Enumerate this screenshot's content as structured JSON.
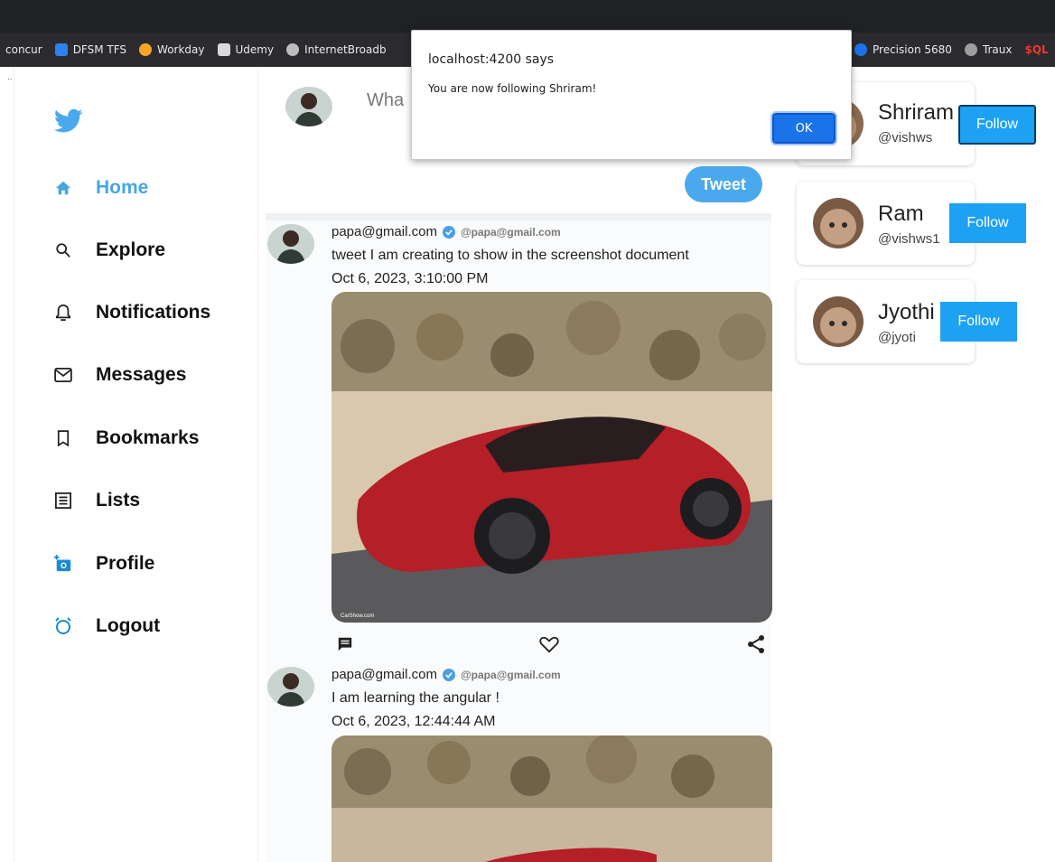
{
  "bookmarks": [
    {
      "label": "concur",
      "color": "#2b2b2f"
    },
    {
      "label": "DFSM TFS",
      "color": "#2f80ed"
    },
    {
      "label": "Workday",
      "color": "#f5a623"
    },
    {
      "label": "Udemy",
      "color": "#d9d9d9"
    },
    {
      "label": "InternetBroadb",
      "color": "#bdbdbd"
    }
  ],
  "bookmarks_right": [
    {
      "label": "Precision 5680",
      "color": "#1a73e8"
    },
    {
      "label": "Traux",
      "color": "#9e9e9e"
    },
    {
      "label": "$QL",
      "color": "#c62828"
    }
  ],
  "sidebar": {
    "items": [
      {
        "label": "Home",
        "icon": "home-icon"
      },
      {
        "label": "Explore",
        "icon": "search-icon"
      },
      {
        "label": "Notifications",
        "icon": "bell-icon"
      },
      {
        "label": "Messages",
        "icon": "mail-icon"
      },
      {
        "label": "Bookmarks",
        "icon": "bookmark-icon"
      },
      {
        "label": "Lists",
        "icon": "list-icon"
      },
      {
        "label": "Profile",
        "icon": "add-photo-icon"
      },
      {
        "label": "Logout",
        "icon": "logout-icon"
      }
    ]
  },
  "compose": {
    "placeholder": "Wha",
    "tweet_label": "Tweet"
  },
  "posts": [
    {
      "user": "papa@gmail.com",
      "handle": "@papa@gmail.com",
      "text": "tweet I am creating to show in the screenshot document",
      "date": "Oct 6, 2023, 3:10:00 PM",
      "credit": "CarShow.com"
    },
    {
      "user": "papa@gmail.com",
      "handle": "@papa@gmail.com",
      "text": "I am learning the angular !",
      "date": "Oct 6, 2023, 12:44:44 AM"
    }
  ],
  "suggestions": [
    {
      "name": "Shriram",
      "handle": "@vishws",
      "button": "Follow"
    },
    {
      "name": "Ram",
      "handle": "@vishws1",
      "button": "Follow"
    },
    {
      "name": "Jyothi",
      "handle": "@jyoti",
      "button": "Follow"
    }
  ],
  "dialog": {
    "title": "localhost:4200 says",
    "message": "You are now following Shriram!",
    "ok_label": "OK"
  },
  "colors": {
    "accent": "#4aa9ec",
    "follow": "#1da1f2",
    "active_nav": "#48a6e6"
  }
}
